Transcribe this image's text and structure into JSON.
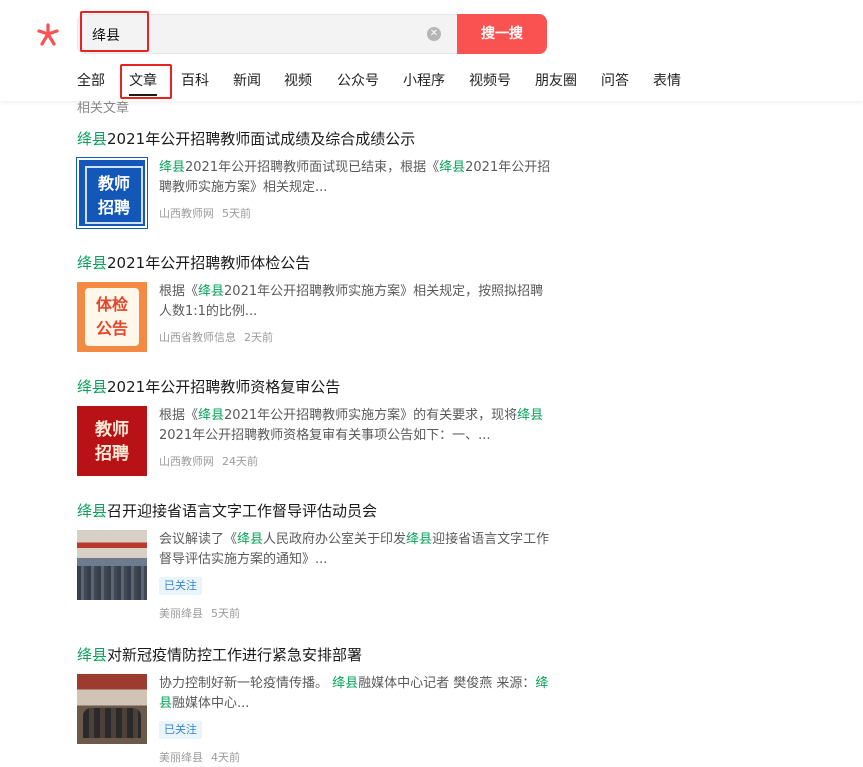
{
  "search": {
    "query": "绛县",
    "clear_icon": "close-circle-icon",
    "button_label": "搜一搜"
  },
  "tabs": [
    "全部",
    "文章",
    "百科",
    "新闻",
    "视频",
    "公众号",
    "小程序",
    "视频号",
    "朋友圈",
    "问答",
    "表情"
  ],
  "active_tab": "文章",
  "section_heading": "相关文章",
  "results": [
    {
      "title_hl": "绛县",
      "title_rest": "2021年公开招聘教师面试成绩及综合成绩公示",
      "thumb_text": [
        "教师",
        "招聘"
      ],
      "snippet_parts": [
        {
          "t": "绛县",
          "hl": true
        },
        {
          "t": "2021年公开招聘教师面试现已结束，根据《",
          "hl": false
        },
        {
          "t": "绛县",
          "hl": true
        },
        {
          "t": "2021年公开招聘教师实施方案》相关规定...",
          "hl": false
        }
      ],
      "source": "山西教师网",
      "time": "5天前"
    },
    {
      "title_hl": "绛县",
      "title_rest": "2021年公开招聘教师体检公告",
      "thumb_text": [
        "体检",
        "公告"
      ],
      "snippet_parts": [
        {
          "t": "根据《",
          "hl": false
        },
        {
          "t": "绛县",
          "hl": true
        },
        {
          "t": "2021年公开招聘教师实施方案》相关规定，按照拟招聘人数1:1的比例...",
          "hl": false
        }
      ],
      "source": "山西省教师信息",
      "time": "2天前"
    },
    {
      "title_hl": "绛县",
      "title_rest": "2021年公开招聘教师资格复审公告",
      "thumb_text": [
        "教师",
        "招聘"
      ],
      "snippet_parts": [
        {
          "t": "根据《",
          "hl": false
        },
        {
          "t": "绛县",
          "hl": true
        },
        {
          "t": "2021年公开招聘教师实施方案》的有关要求，现将",
          "hl": false
        },
        {
          "t": "绛县",
          "hl": true
        },
        {
          "t": "2021年公开招聘教师资格复审有关事项公告如下：一、...",
          "hl": false
        }
      ],
      "source": "山西教师网",
      "time": "24天前"
    },
    {
      "title_hl": "绛县",
      "title_rest": "召开迎接省语言文字工作督导评估动员会",
      "snippet_parts": [
        {
          "t": "会议解读了《",
          "hl": false
        },
        {
          "t": "绛县",
          "hl": true
        },
        {
          "t": "人民政府办公室关于印发",
          "hl": false
        },
        {
          "t": "绛县",
          "hl": true
        },
        {
          "t": "迎接省语言文字工作督导评估实施方案的通知》...",
          "hl": false
        }
      ],
      "badge": "已关注",
      "source": "美丽绛县",
      "time": "5天前"
    },
    {
      "title_hl": "绛县",
      "title_rest": "对新冠疫情防控工作进行紧急安排部署",
      "snippet_parts": [
        {
          "t": "协力控制好新一轮疫情传播。 ",
          "hl": false
        },
        {
          "t": "绛县",
          "hl": true
        },
        {
          "t": "融媒体中心记者 樊俊燕 来源：",
          "hl": false
        },
        {
          "t": "绛县",
          "hl": true
        },
        {
          "t": "融媒体中心...",
          "hl": false
        }
      ],
      "badge": "已关注",
      "source": "美丽绛县",
      "time": "4天前"
    }
  ],
  "colors": {
    "accent": "#fa5151",
    "highlight": "#07a35a",
    "annotation_frame": "#e5231f"
  }
}
